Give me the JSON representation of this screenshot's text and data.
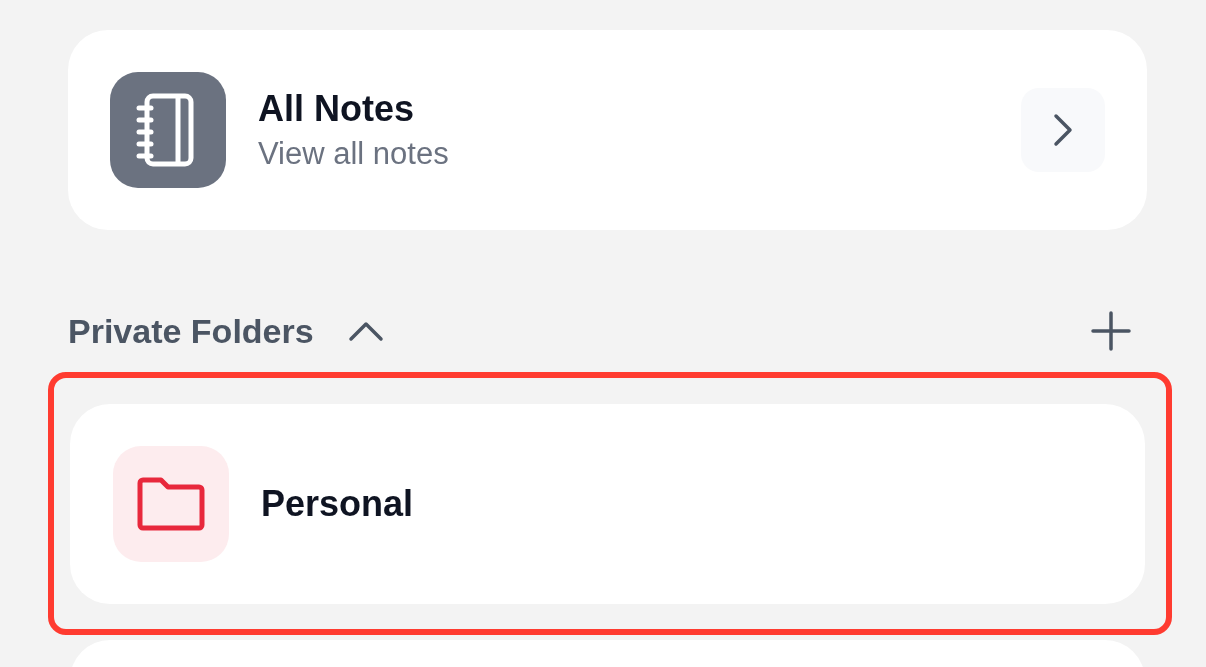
{
  "all_notes": {
    "title": "All Notes",
    "subtitle": "View all notes"
  },
  "section": {
    "title": "Private Folders",
    "expanded": true
  },
  "folders": [
    {
      "name": "Personal",
      "highlighted": true
    },
    {
      "highlighted": false
    }
  ]
}
